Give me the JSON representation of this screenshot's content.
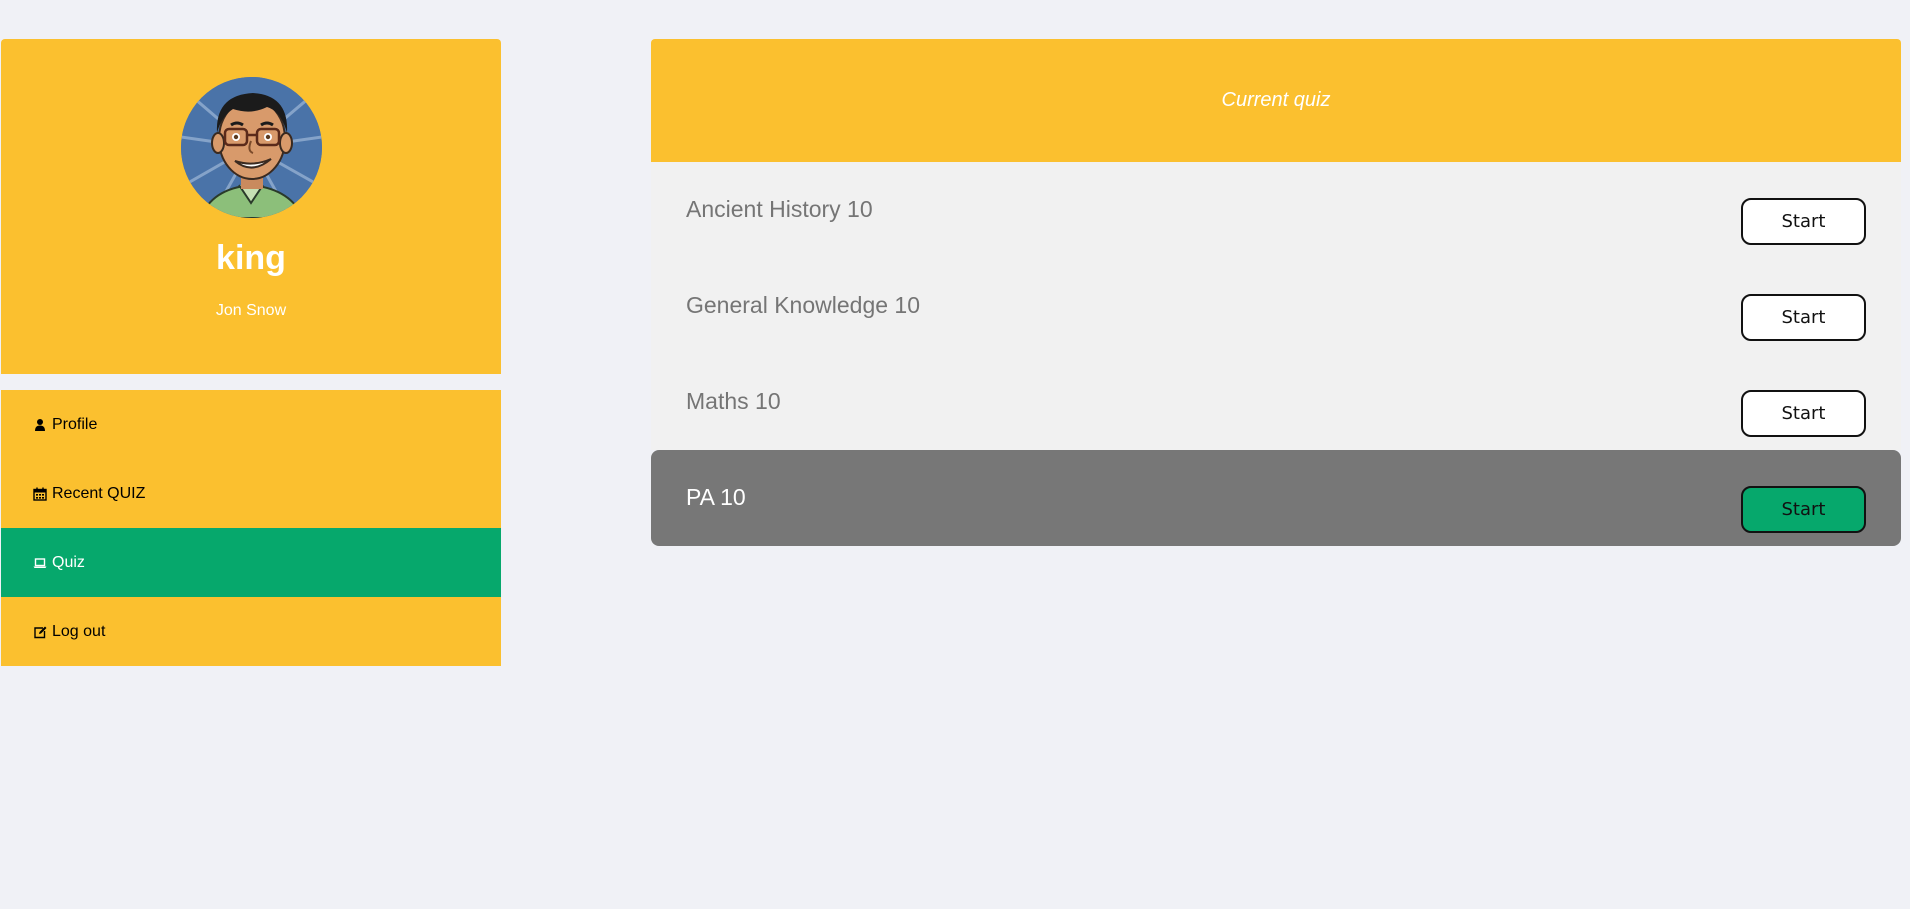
{
  "profile": {
    "username": "king",
    "fullname": "Jon Snow"
  },
  "sidebar": {
    "items": [
      {
        "label": "Profile",
        "icon": "user-icon"
      },
      {
        "label": "Recent QUIZ",
        "icon": "calendar-icon"
      },
      {
        "label": "Quiz",
        "icon": "laptop-icon",
        "active": true
      },
      {
        "label": "Log out",
        "icon": "edit-icon"
      }
    ]
  },
  "quiz": {
    "header": "Current quiz",
    "rows": [
      {
        "name": "Ancient History 10",
        "button": "Start"
      },
      {
        "name": "General Knowledge 10",
        "button": "Start"
      },
      {
        "name": "Maths 10",
        "button": "Start"
      },
      {
        "name": "PA 10",
        "button": "Start",
        "highlighted": true
      }
    ]
  },
  "colors": {
    "accent_yellow": "#fbc02f",
    "active_green": "#06a86c",
    "highlight_gray": "#777777",
    "background": "#f0f1f6"
  }
}
